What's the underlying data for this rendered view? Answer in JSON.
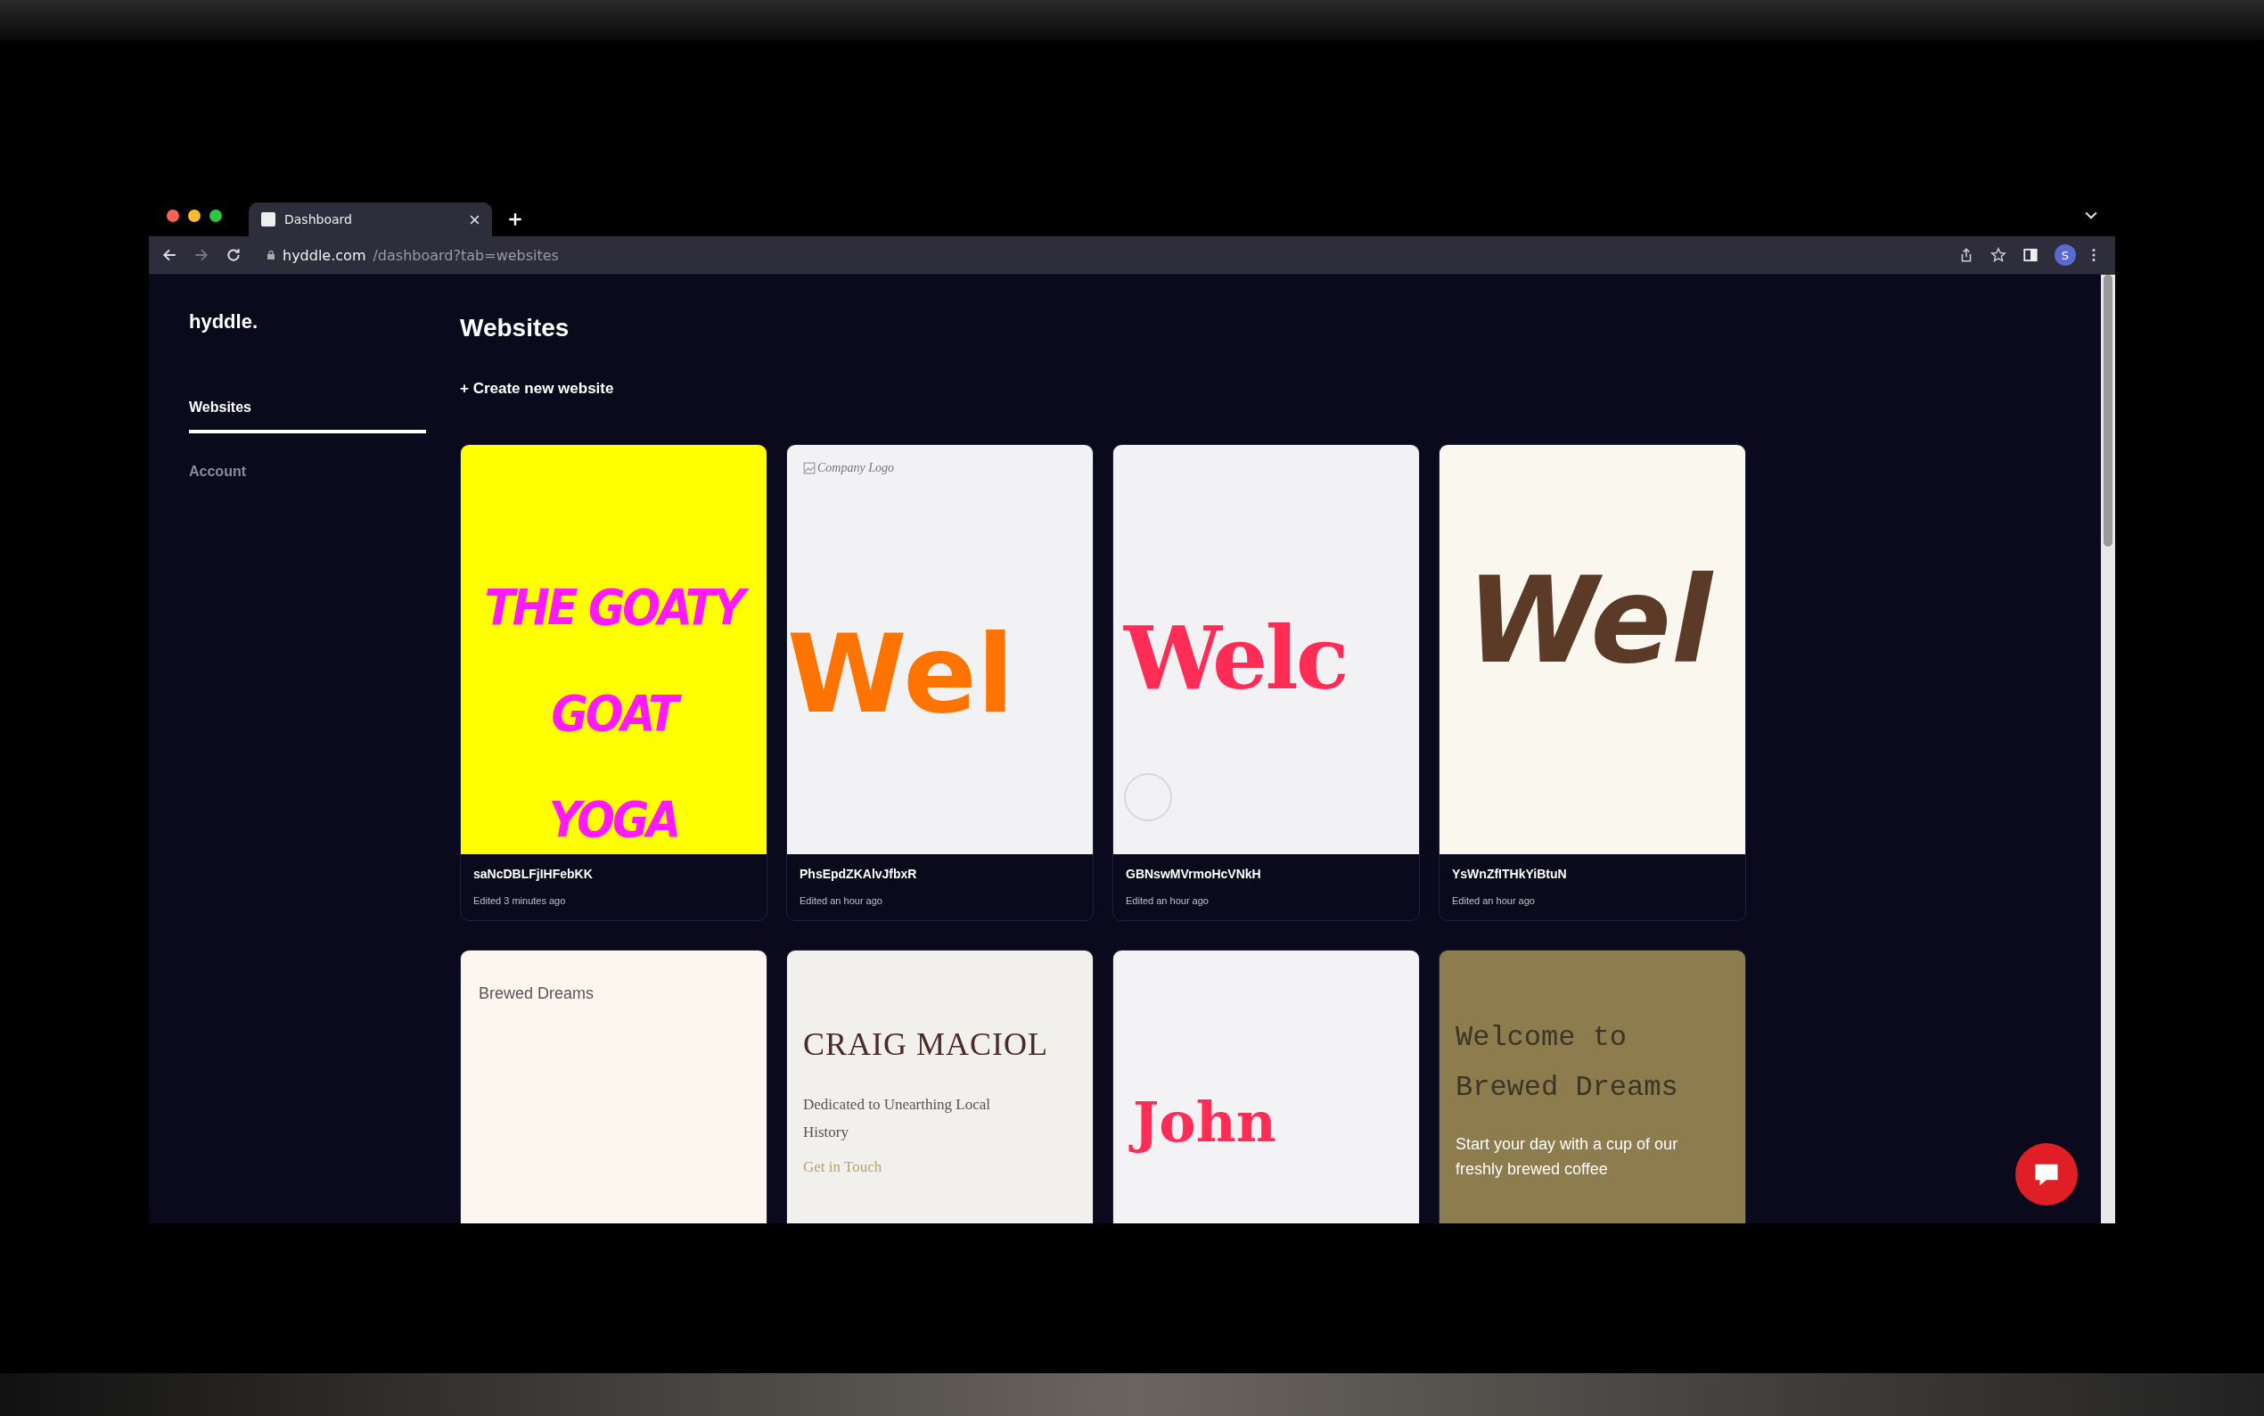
{
  "browser": {
    "tabs": [
      {
        "title": "Dashboard",
        "selected": true
      }
    ],
    "url_host": "hyddle.com",
    "url_path": "/dashboard?tab=websites",
    "profile_initial": "S"
  },
  "sidebar": {
    "logo": "hyddle.",
    "items": [
      {
        "label": "Websites",
        "selected": true
      },
      {
        "label": "Account",
        "selected": false
      }
    ]
  },
  "main": {
    "title": "Websites",
    "create_link": "+ Create new website",
    "sites": [
      {
        "preview": {
          "kind": "yoga",
          "elements": [
            {
              "kind": "poster",
              "text": "THE GOATY"
            },
            {
              "kind": "poster",
              "text": "GOAT"
            },
            {
              "kind": "poster",
              "text": "YOGA"
            }
          ]
        },
        "name": "saNcDBLFjIHFebKK",
        "edited": "Edited 3 minutes ago"
      },
      {
        "preview": {
          "kind": "orange",
          "elements": [
            {
              "kind": "alt",
              "text": "Company Logo"
            },
            {
              "kind": "headline",
              "text": "Wel"
            }
          ]
        },
        "name": "PhsEpdZKAlvJfbxR",
        "edited": "Edited an hour ago"
      },
      {
        "preview": {
          "kind": "pink",
          "elements": [
            {
              "kind": "headline",
              "text": "Welc"
            },
            {
              "kind": "ring"
            }
          ]
        },
        "name": "GBNswMVrmoHcVNkH",
        "edited": "Edited an hour ago"
      },
      {
        "preview": {
          "kind": "cocoa",
          "elements": [
            {
              "kind": "headline",
              "text": "Wel"
            }
          ]
        },
        "name": "YsWnZfITHkYiBtuN",
        "edited": "Edited an hour ago"
      },
      {
        "preview": {
          "kind": "cream",
          "elements": [
            {
              "kind": "logo",
              "text": "Brewed Dreams"
            }
          ]
        }
      },
      {
        "preview": {
          "kind": "serif",
          "elements": [
            {
              "kind": "logo",
              "text": "CRAIG MACIOL"
            },
            {
              "kind": "body",
              "text": "Dedicated to Unearthing Local History"
            },
            {
              "kind": "link",
              "text": "Get in Touch"
            }
          ]
        }
      },
      {
        "preview": {
          "kind": "john",
          "elements": [
            {
              "kind": "headline",
              "text": "John"
            }
          ]
        }
      },
      {
        "preview": {
          "kind": "olive",
          "elements": [
            {
              "kind": "headline",
              "text": "Welcome to Brewed Dreams"
            },
            {
              "kind": "body",
              "text": "Start your day with a cup of our freshly brewed coffee"
            }
          ]
        }
      }
    ]
  }
}
